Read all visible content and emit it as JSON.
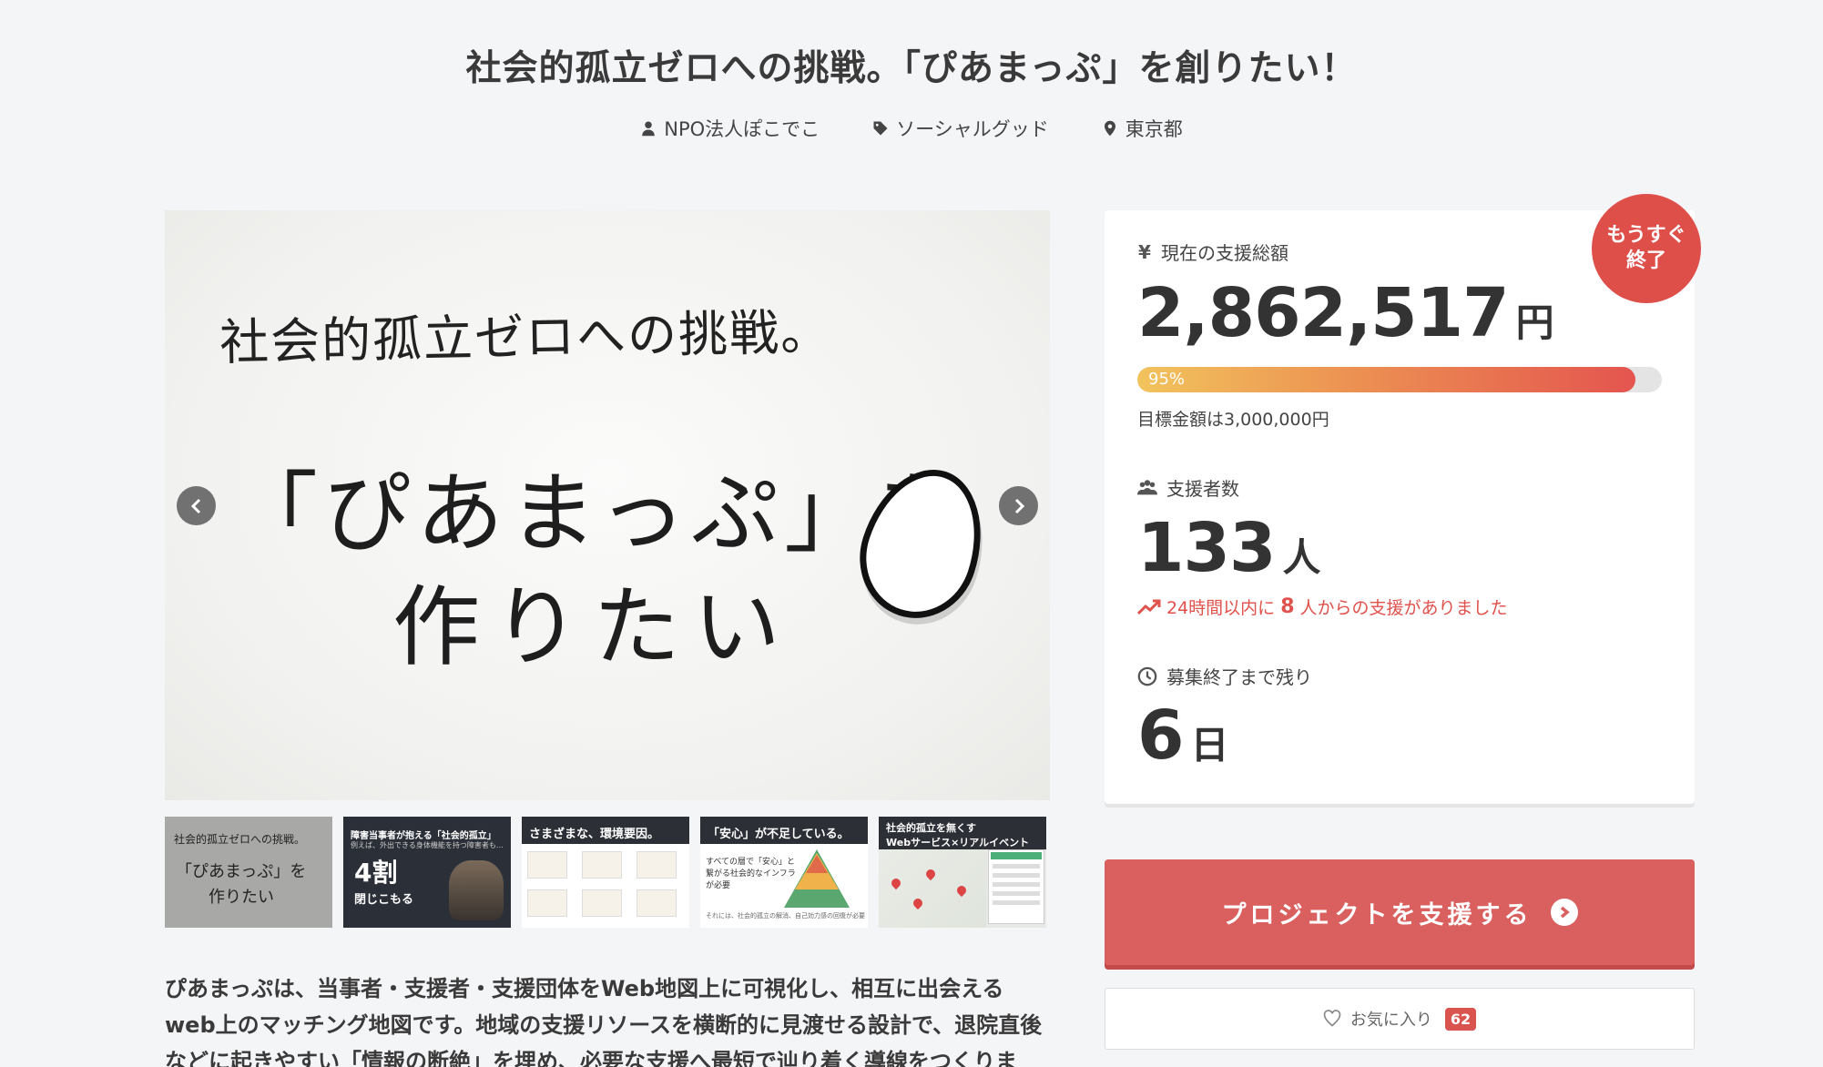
{
  "project": {
    "title": "社会的孤立ゼロへの挑戦。「ぴあまっぷ」を創りたい！",
    "owner": "NPO法人ぽこでこ",
    "category": "ソーシャルグッド",
    "location": "東京都"
  },
  "hero": {
    "line1": "社会的孤立ゼロへの挑戦。",
    "line2": "「ぴあまっぷ」を",
    "line3": "作りたい"
  },
  "thumbnails": [
    {
      "l1": "社会的孤立ゼロへの挑戦。",
      "l2": "「ぴあまっぷ」を",
      "l3": "作りたい"
    },
    {
      "l1": "障害当事者が抱える「社会的孤立」",
      "l2": "例えば、外出できる身体機能を持つ障害者も…",
      "big": "4割",
      "l3": "閉じこもる"
    },
    {
      "hdr": "さまざまな、環境要因。"
    },
    {
      "hdr": "「安心」が不足している。",
      "txt": "すべての層で「安心」と\n繋がる社会的なインフラ\nが必要",
      "foot": "それには、社会的孤立の解消、自己効力感の回復が必要"
    },
    {
      "hdr": "社会的孤立を無くす\nWebサービス×リアルイベント"
    }
  ],
  "description": "ぴあまっぷは、当事者・支援者・支援団体をWeb地図上に可視化し、相互に出会えるweb上のマッチング地図です。地域の支援リソースを横断的に見渡せる設計で、退院直後などに起きやすい「情報の断絶」を埋め、必要な支援へ最短で辿り着く導線をつくります。",
  "stats": {
    "badge_line1": "もうすぐ",
    "badge_line2": "終了",
    "amount_label": "現在の支援総額",
    "amount": "2,862,517",
    "amount_unit": "円",
    "progress_percent": 95,
    "progress_label": "95%",
    "goal_text": "目標金額は3,000,000円",
    "backers_label": "支援者数",
    "backers": "133",
    "backers_unit": "人",
    "trend_prefix": "24時間以内に",
    "trend_count": "8",
    "trend_suffix": "人からの支援がありました",
    "remaining_label": "募集終了まで残り",
    "remaining": "6",
    "remaining_unit": "日"
  },
  "actions": {
    "support_label": "プロジェクトを支援する",
    "favorite_label": "お気に入り",
    "favorite_count": "62"
  },
  "colors": {
    "accent": "#d9605f",
    "badge": "#de4f4a",
    "trend": "#e0524c",
    "progress_start": "#f2c35c",
    "progress_end": "#e4554f"
  }
}
